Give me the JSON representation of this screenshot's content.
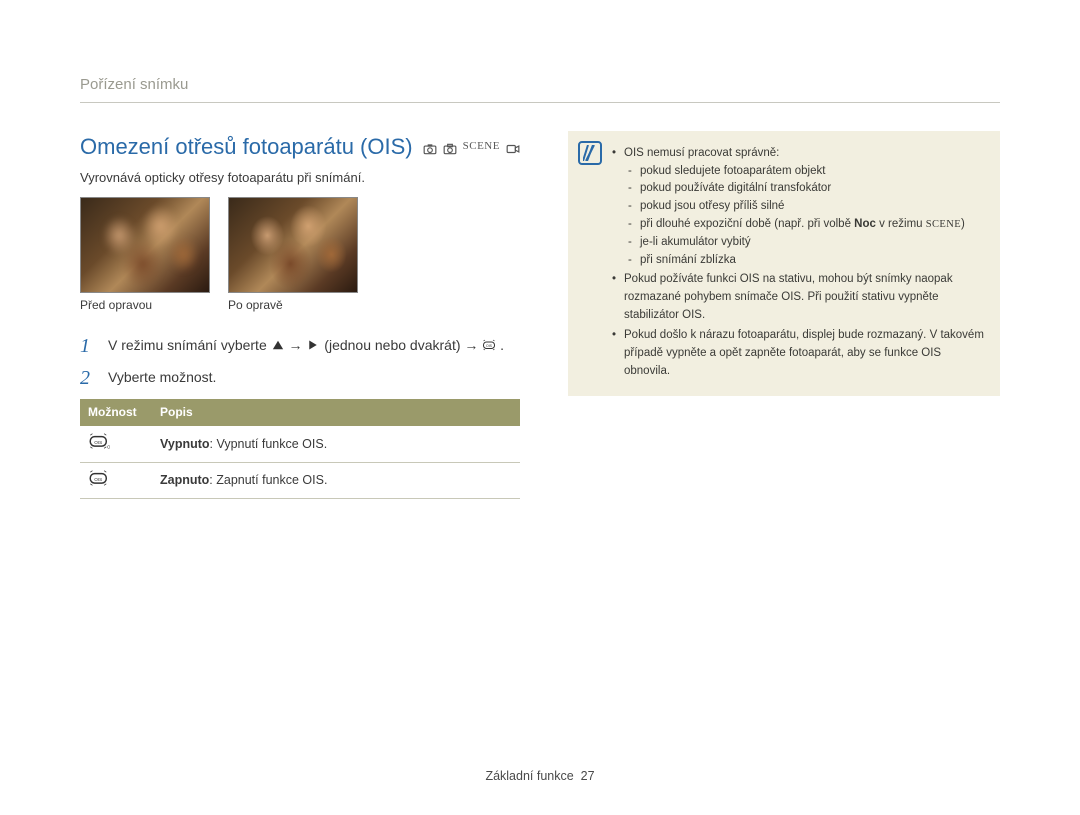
{
  "breadcrumb": "Pořízení snímku",
  "title": "Omezení otřesů fotoaparátu (OIS)",
  "mode_scene_label": "SCENE",
  "intro": "Vyrovnává opticky otřesy fotoaparátu při snímání.",
  "photos": {
    "before_caption": "Před opravou",
    "after_caption": "Po opravě"
  },
  "steps": [
    {
      "num": "1",
      "pre": "V režimu snímání vyberte ",
      "mid1": " → ",
      "mid2": " (jednou nebo dvakrát) → ",
      "post": "."
    },
    {
      "num": "2",
      "text": "Vyberte možnost."
    }
  ],
  "table": {
    "col_option": "Možnost",
    "col_desc": "Popis",
    "rows": [
      {
        "icon": "ois-off-icon",
        "label": "Vypnuto",
        "desc": ": Vypnutí funkce OIS."
      },
      {
        "icon": "ois-on-icon",
        "label": "Zapnuto",
        "desc": ": Zapnutí funkce OIS."
      }
    ]
  },
  "note": {
    "head": "OIS nemusí pracovat správně:",
    "sub": [
      "pokud sledujete fotoaparátem objekt",
      "pokud používáte digitální transfokátor",
      "pokud jsou otřesy příliš silné",
      "při dlouhé expoziční době (např. při volbě ",
      "je-li akumulátor vybitý",
      "při snímání zblízka"
    ],
    "sub_noc_bold": "Noc",
    "sub_noc_tail": " v režimu ",
    "sub_noc_scene": "SCENE",
    "sub_noc_close": ")",
    "bullets_after": [
      "Pokud požíváte funkci OIS na stativu, mohou být snímky naopak rozmazané pohybem snímače OIS. Při použití stativu vypněte stabilizátor OIS.",
      "Pokud došlo k nárazu fotoaparátu, displej bude rozmazaný. V takovém případě vypněte a opět zapněte fotoaparát, aby se funkce OIS obnovila."
    ]
  },
  "footer_label": "Základní funkce",
  "footer_page": "27"
}
